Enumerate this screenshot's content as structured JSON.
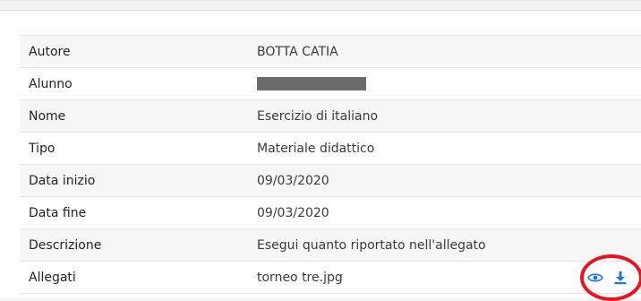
{
  "details": {
    "rows": [
      {
        "label": "Autore",
        "value": "BOTTA CATIA"
      },
      {
        "label": "Alunno",
        "value": ""
      },
      {
        "label": "Nome",
        "value": "Esercizio di italiano"
      },
      {
        "label": "Tipo",
        "value": "Materiale didattico"
      },
      {
        "label": "Data inizio",
        "value": "09/03/2020"
      },
      {
        "label": "Data fine",
        "value": "09/03/2020"
      },
      {
        "label": "Descrizione",
        "value": "Esegui quanto riportato nell'allegato"
      },
      {
        "label": "Allegati",
        "value": "torneo tre.jpg"
      }
    ]
  },
  "attachment_actions": {
    "view_icon": "eye-icon",
    "download_icon": "download-icon",
    "icon_color": "#1a73e8"
  },
  "annotation": {
    "ring_color": "#e8141e"
  }
}
